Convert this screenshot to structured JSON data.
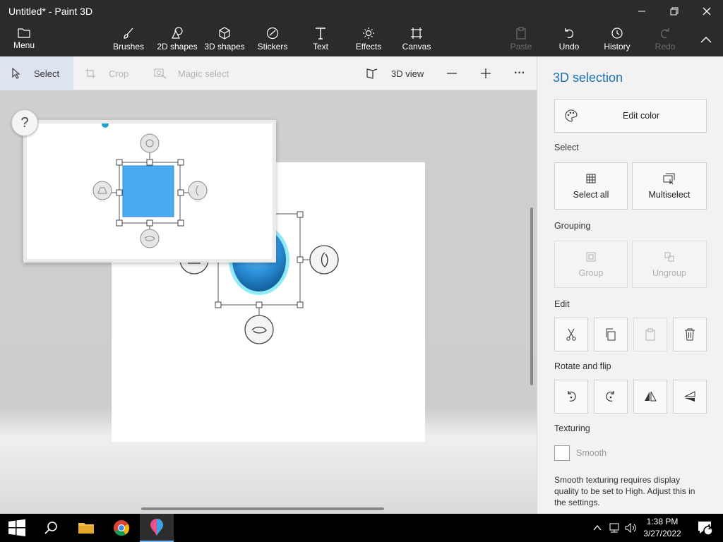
{
  "window": {
    "title": "Untitled* - Paint 3D"
  },
  "ribbon": {
    "menu": "Menu",
    "tools": [
      "Brushes",
      "2D shapes",
      "3D shapes",
      "Stickers",
      "Text",
      "Effects",
      "Canvas"
    ],
    "paste": "Paste",
    "undo": "Undo",
    "history": "History",
    "redo": "Redo"
  },
  "subbar": {
    "select": "Select",
    "crop": "Crop",
    "magic_select": "Magic select",
    "view3d": "3D view",
    "more": "···"
  },
  "canvas": {
    "help": "?"
  },
  "panel": {
    "title": "3D selection",
    "edit_color": "Edit color",
    "select_heading": "Select",
    "select_all": "Select all",
    "multiselect": "Multiselect",
    "grouping_heading": "Grouping",
    "group": "Group",
    "ungroup": "Ungroup",
    "edit_heading": "Edit",
    "rotate_heading": "Rotate and flip",
    "texturing_heading": "Texturing",
    "smooth": "Smooth",
    "note": "Smooth texturing requires display quality to be set to High. Adjust this in the settings."
  },
  "taskbar": {
    "time": "1:38 PM",
    "date": "3/27/2022",
    "notifications": "1"
  },
  "colors": {
    "accent": "#1f6fb2",
    "shape_blue": "#4aabf2",
    "chrome": "#2b2b2b"
  }
}
